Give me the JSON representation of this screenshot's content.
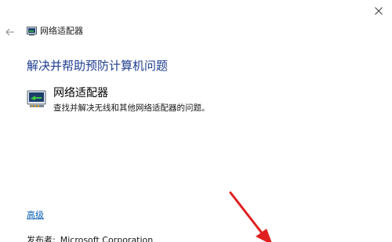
{
  "window": {
    "title": "网络适配器"
  },
  "main": {
    "heading": "解决并帮助预防计算机问题",
    "item": {
      "title": "网络适配器",
      "description": "查找并解决无线和其他网络适配器的问题。"
    },
    "advanced_label": "高级",
    "publisher_label": "发布者:",
    "publisher_value": "Microsoft Corporation"
  },
  "colors": {
    "heading": "#1e3d8f",
    "link": "#0a5fb4",
    "annotation_arrow": "#e02020"
  },
  "icons": [
    "close-icon",
    "back-arrow-icon",
    "network-adapter-icon"
  ]
}
